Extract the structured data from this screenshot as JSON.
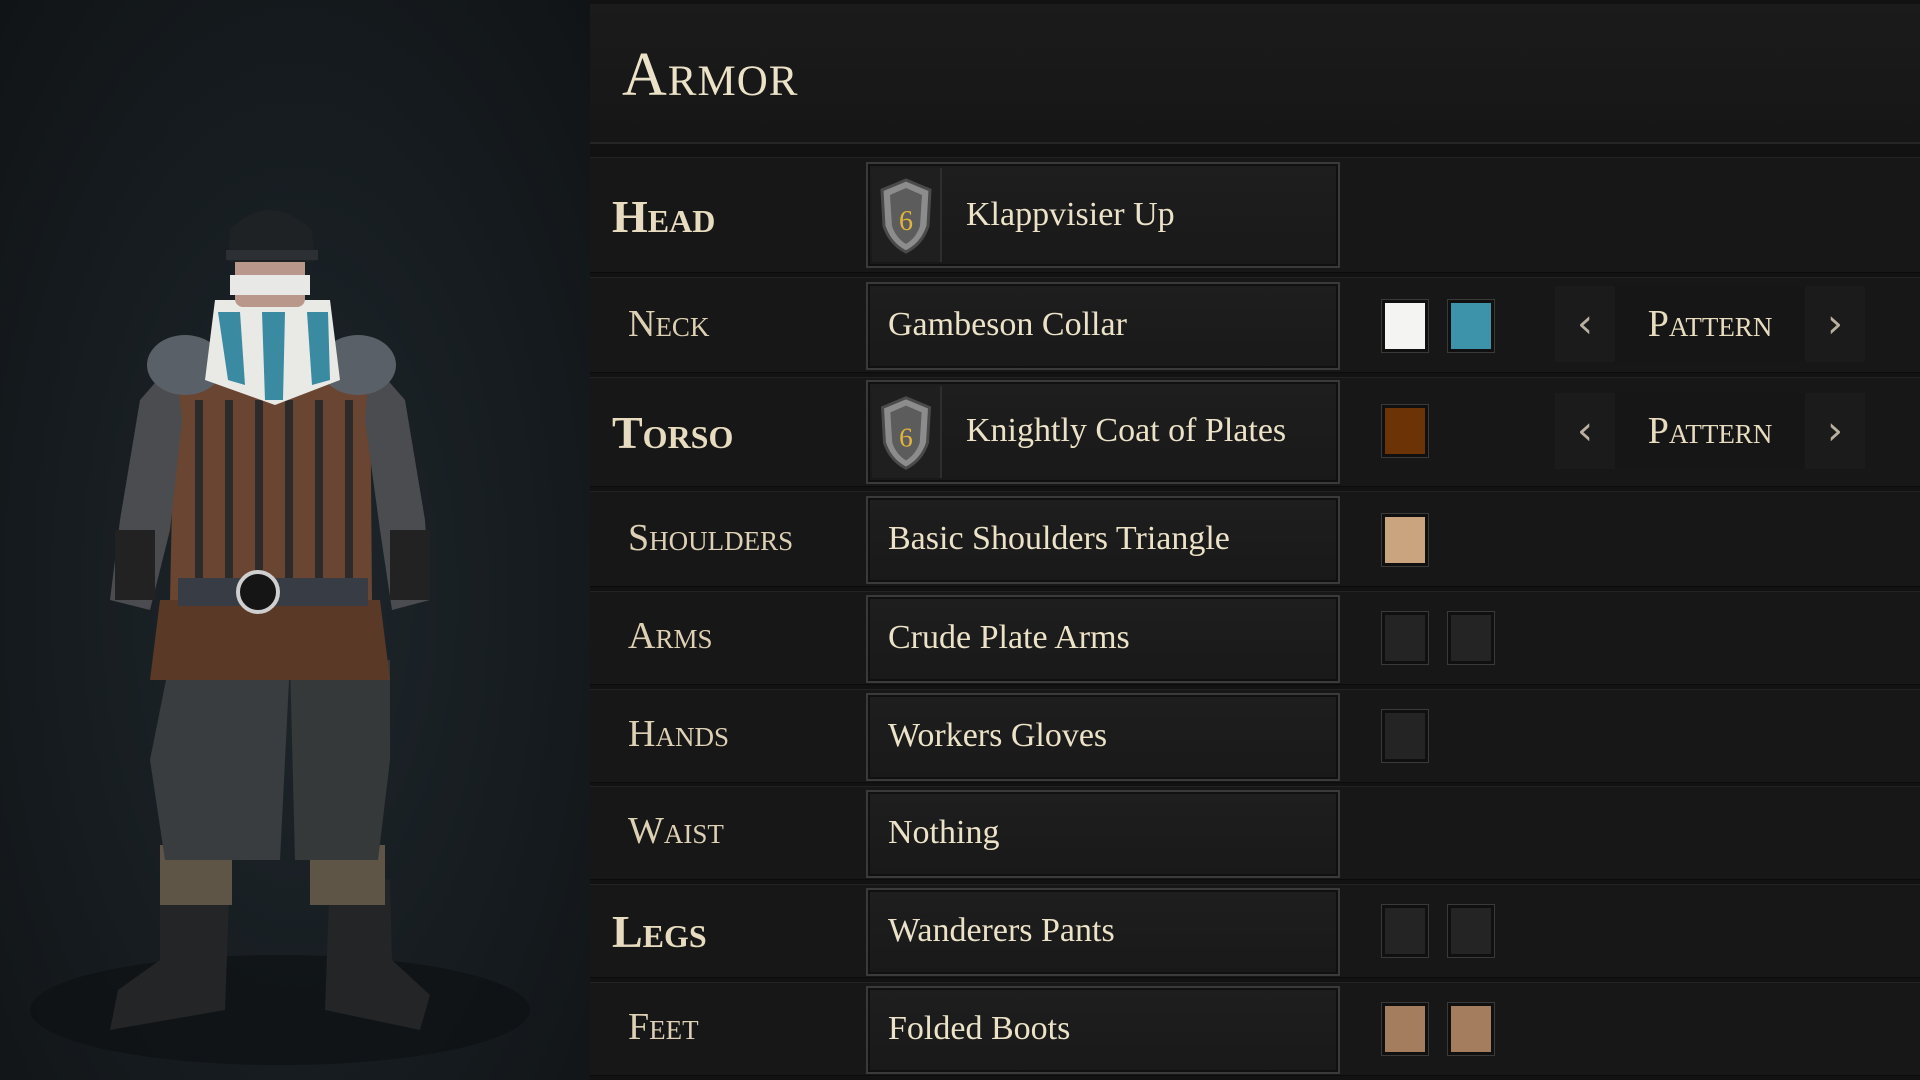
{
  "panel": {
    "title": "Armor"
  },
  "slots": [
    {
      "label": "Head",
      "item": "Klappvisier Up",
      "tier": "6",
      "colors": [],
      "pattern": false
    },
    {
      "label": "Neck",
      "item": "Gambeson Collar",
      "colors": [
        "#f4f4f2",
        "#3d93aa"
      ],
      "pattern": true
    },
    {
      "label": "Torso",
      "item": "Knightly Coat of Plates",
      "tier": "6",
      "colors": [
        "#6b3306"
      ],
      "pattern": true
    },
    {
      "label": "Shoulders",
      "item": "Basic Shoulders Triangle",
      "colors": [
        "#c9a47f"
      ],
      "pattern": false
    },
    {
      "label": "Arms",
      "item": "Crude Plate Arms",
      "colors": [
        "#242424",
        "#242424"
      ],
      "pattern": false
    },
    {
      "label": "Hands",
      "item": "Workers Gloves",
      "colors": [
        "#242424"
      ],
      "pattern": false
    },
    {
      "label": "Waist",
      "item": "Nothing",
      "colors": [],
      "pattern": false
    },
    {
      "label": "Legs",
      "item": "Wanderers Pants",
      "colors": [
        "#242424",
        "#242424"
      ],
      "pattern": false
    },
    {
      "label": "Feet",
      "item": "Folded Boots",
      "colors": [
        "#a37d5e",
        "#a37d5e"
      ],
      "pattern": false
    }
  ],
  "pattern_control": {
    "label": "Pattern",
    "prev_icon": "chevron-left-icon",
    "next_icon": "chevron-right-icon"
  },
  "icons": {
    "tier": "shield-badge-icon"
  }
}
